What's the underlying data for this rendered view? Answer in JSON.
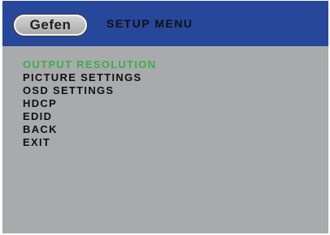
{
  "header": {
    "logo_text": "Gefen",
    "title": "SETUP MENU"
  },
  "menu": {
    "selected_index": 0,
    "items": [
      {
        "label": "OUTPUT RESOLUTION"
      },
      {
        "label": "PICTURE SETTINGS"
      },
      {
        "label": "OSD SETTINGS"
      },
      {
        "label": "HDCP"
      },
      {
        "label": "EDID"
      },
      {
        "label": "BACK"
      },
      {
        "label": "EXIT"
      }
    ]
  },
  "colors": {
    "header_bg": "#26479a",
    "screen_bg": "#a9aaac",
    "selected_text": "#3cae49",
    "text": "#111111"
  }
}
